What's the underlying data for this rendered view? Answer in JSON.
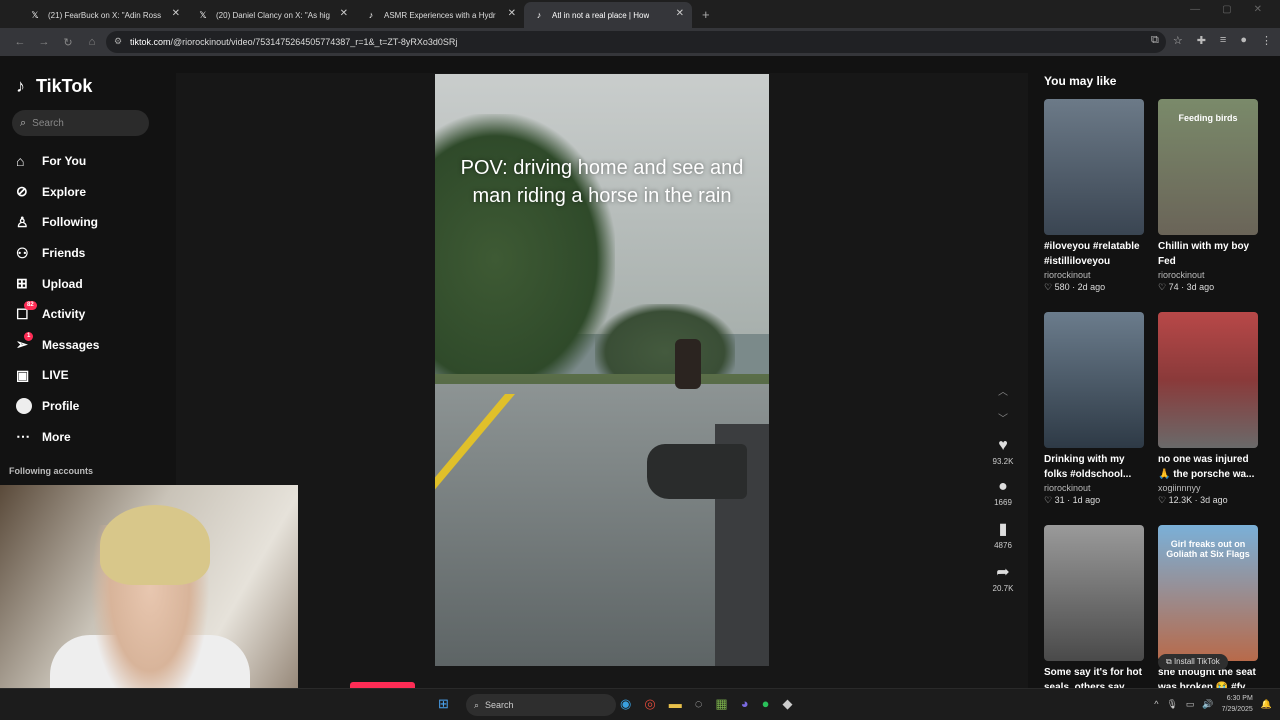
{
  "browser": {
    "tabs": [
      {
        "title": "(21) FearBuck on X: \"Adin Ross",
        "icon": "x-icon"
      },
      {
        "title": "(20) Daniel Clancy on X: \"As hig",
        "icon": "x-icon"
      },
      {
        "title": "ASMR Experiences with a Hydr",
        "icon": "tiktok-icon"
      },
      {
        "title": "Atl in not a real place | How",
        "icon": "tiktok-icon"
      }
    ],
    "url_host": "tiktok.com",
    "url_path": "/@riorockinout/video/7531475264505774387_r=1&_t=ZT-8yRXo3d0SRj"
  },
  "sidebar": {
    "logo": "TikTok",
    "search_placeholder": "Search",
    "items": [
      {
        "label": "For You",
        "icon": "home-icon"
      },
      {
        "label": "Explore",
        "icon": "compass-icon"
      },
      {
        "label": "Following",
        "icon": "following-icon"
      },
      {
        "label": "Friends",
        "icon": "friends-icon"
      },
      {
        "label": "Upload",
        "icon": "upload-icon"
      },
      {
        "label": "Activity",
        "icon": "activity-icon",
        "badge": "82"
      },
      {
        "label": "Messages",
        "icon": "messages-icon",
        "badge": "1"
      },
      {
        "label": "LIVE",
        "icon": "live-icon"
      },
      {
        "label": "Profile",
        "icon": "profile-icon"
      },
      {
        "label": "More",
        "icon": "more-icon"
      }
    ],
    "following_accounts": "Following accounts"
  },
  "video": {
    "caption": "POV: driving home and see and man riding a horse in the rain",
    "likes": "93.2K",
    "comments": "1669",
    "saves": "4876",
    "shares": "20.7K"
  },
  "recommend": {
    "heading": "You may like",
    "cards": [
      {
        "title": "#iloveyou #relatable #istilliloveyou #real...",
        "user": "riorockinout",
        "likes": "580",
        "age": "2d ago",
        "overlay": "",
        "color": "#4a5a6a"
      },
      {
        "title": "Chillin with my boy Fed",
        "user": "riorockinout",
        "likes": "74",
        "age": "3d ago",
        "overlay": "Feeding birds",
        "color": "#6a6a58"
      },
      {
        "title": "Drinking with my folks #oldschool...",
        "user": "riorockinout",
        "likes": "31",
        "age": "1d ago",
        "overlay": "",
        "color": "#3a4a5a"
      },
      {
        "title": "no one was injured 🙏 the porsche wa...",
        "user": "xogiinnnyy",
        "likes": "12.3K",
        "age": "3d ago",
        "overlay": "",
        "color": "#9a4a4a"
      },
      {
        "title": "Some say it's for hot seals, others say it'...",
        "user": "",
        "likes": "",
        "age": "",
        "overlay": "",
        "color": "#5a5a5a"
      },
      {
        "title": "she thought the seat was broken 😭 #fy...",
        "user": "",
        "likes": "",
        "age": "",
        "overlay": "Girl freaks out on Goliath at Six Flags",
        "color": "#5a8aa8"
      }
    ],
    "install": "Install TikTok"
  },
  "taskbar": {
    "search": "Search",
    "time": "6:30 PM",
    "date": "7/29/2025"
  }
}
